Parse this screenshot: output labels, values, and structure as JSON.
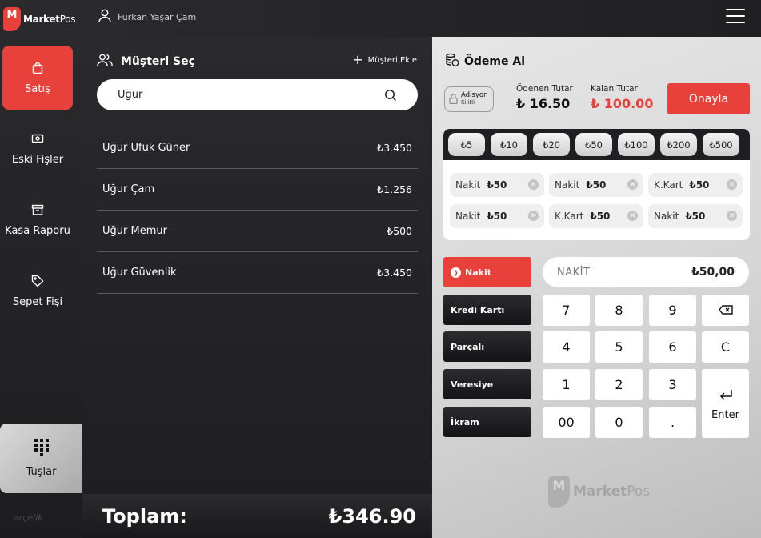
{
  "brand": {
    "mark": "M",
    "name_bold": "Market",
    "name_thin": "Pos",
    "footer": "arçelik"
  },
  "user": {
    "name": "Furkan Yaşar Çam"
  },
  "sidebar": {
    "items": [
      {
        "label": "Satış",
        "icon": "shopping-bag-icon",
        "active": true
      },
      {
        "label": "Eski Fişler",
        "icon": "receipt-icon",
        "active": false
      },
      {
        "label": "Kasa Raporu",
        "icon": "archive-box-icon",
        "active": false
      },
      {
        "label": "Sepet Fişi",
        "icon": "tag-icon",
        "active": false
      }
    ],
    "keypad_toggle": {
      "label": "Tuşlar",
      "icon": "keypad-grid-icon"
    }
  },
  "customer": {
    "title": "Müşteri Seç",
    "add_label": "Müşteri Ekle",
    "search_value": "Uğur",
    "rows": [
      {
        "name": "Uğur Ufuk Güner",
        "balance": "₺3.450"
      },
      {
        "name": "Uğur Çam",
        "balance": "₺1.256"
      },
      {
        "name": "Uğur Memur",
        "balance": "₺500"
      },
      {
        "name": "Uğur Güvenlik",
        "balance": "₺3.450"
      }
    ],
    "total_label": "Toplam:",
    "total_value": "₺346.90"
  },
  "payment": {
    "title": "Ödeme Al",
    "adisyon_line1": "Adisyon",
    "adisyon_line2": "Kilitli",
    "paid_label": "Ödenen Tutar",
    "paid_value": "₺ 16.50",
    "remain_label": "Kalan Tutar",
    "remain_value": "₺ 100.00",
    "confirm_label": "Onayla",
    "cash_chips": [
      "₺5",
      "₺10",
      "₺20",
      "₺50",
      "₺100",
      "₺200",
      "₺500"
    ],
    "entries": [
      {
        "type": "Nakit",
        "amount": "₺50"
      },
      {
        "type": "Nakit",
        "amount": "₺50"
      },
      {
        "type": "K.Kart",
        "amount": "₺50"
      },
      {
        "type": "Nakit",
        "amount": "₺50"
      },
      {
        "type": "K.Kart",
        "amount": "₺50"
      },
      {
        "type": "Nakit",
        "amount": "₺50"
      }
    ],
    "methods": [
      "Nakit",
      "Kredi Kartı",
      "Parçalı",
      "Veresiye",
      "İkram"
    ],
    "amount_type": "NAKİT",
    "amount_value": "₺50,00",
    "keys": {
      "k7": "7",
      "k8": "8",
      "k9": "9",
      "k4": "4",
      "k5": "5",
      "k6": "6",
      "clear": "C",
      "k1": "1",
      "k2": "2",
      "k3": "3",
      "k00": "00",
      "k0": "0",
      "dot": ".",
      "enter": "Enter"
    }
  },
  "colors": {
    "accent": "#e8413b",
    "dark": "#1f1f21",
    "light": "#e6e6e6"
  }
}
